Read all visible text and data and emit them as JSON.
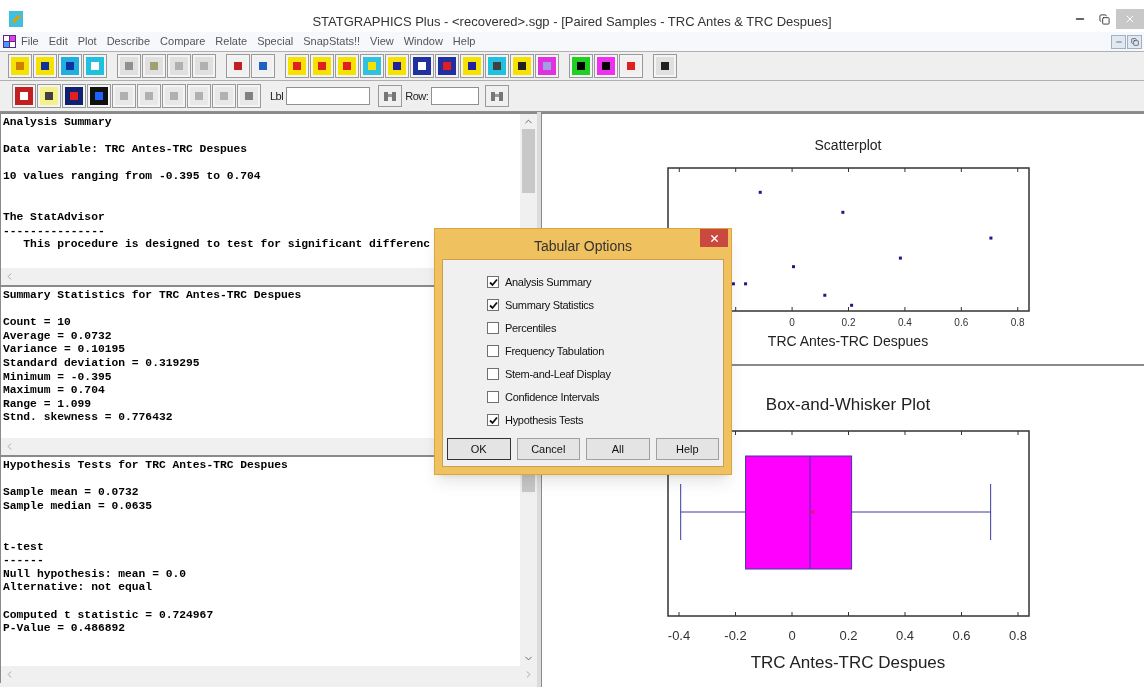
{
  "window": {
    "title": "STATGRAPHICS Plus - <recovered>.sgp - [Paired Samples - TRC Antes & TRC Despues]"
  },
  "menu": [
    "File",
    "Edit",
    "Plot",
    "Describe",
    "Compare",
    "Relate",
    "Special",
    "SnapStats!!",
    "View",
    "Window",
    "Help"
  ],
  "toolbar2": {
    "label_field": {
      "label": "Lbl"
    },
    "row_field": {
      "label": "Row:"
    }
  },
  "panes": [
    {
      "groups": [
        {
          "kind": "para",
          "lines": [
            "Analysis Summary"
          ]
        },
        {
          "kind": "para",
          "lines": [
            "Data variable: TRC Antes-TRC Despues"
          ]
        },
        {
          "kind": "para",
          "lines": [
            "10 values ranging from -0.395 to 0.704"
          ]
        },
        {
          "kind": "section",
          "lines": [
            "The StatAdvisor",
            "---------------",
            "   This procedure is designed to test for significant differenc"
          ]
        }
      ]
    },
    {
      "groups": [
        {
          "kind": "para",
          "lines": [
            "Summary Statistics for TRC Antes-TRC Despues"
          ]
        },
        {
          "kind": "para",
          "lines": [
            "Count = 10",
            "Average = 0.0732",
            "Variance = 0.10195",
            "Standard deviation = 0.319295",
            "Minimum = -0.395",
            "Maximum = 0.704",
            "Range = 1.099",
            "Stnd. skewness = 0.776432"
          ]
        }
      ]
    },
    {
      "groups": [
        {
          "kind": "para",
          "lines": [
            "Hypothesis Tests for TRC Antes-TRC Despues"
          ]
        },
        {
          "kind": "para",
          "lines": [
            "Sample mean = 0.0732",
            "Sample median = 0.0635"
          ]
        },
        {
          "kind": "section",
          "lines": [
            "t-test",
            "------",
            "Null hypothesis: mean = 0.0",
            "Alternative: not equal"
          ]
        },
        {
          "kind": "para",
          "lines": [
            "Computed t statistic = 0.724967",
            "P-Value = 0.486892"
          ]
        }
      ]
    }
  ],
  "scatterplot": {
    "title": "Scatterplot",
    "xlabel": "TRC Antes-TRC Despues",
    "tick_labels": [
      "0",
      "0.2",
      "0.4",
      "0.6",
      "0.8"
    ]
  },
  "boxplot": {
    "title": "Box-and-Whisker Plot",
    "xlabel": "TRC Antes-TRC Despues",
    "tick_labels": [
      "-0.4",
      "-0.2",
      "0",
      "0.2",
      "0.4",
      "0.6",
      "0.8"
    ]
  },
  "dialog": {
    "title": "Tabular Options",
    "options": [
      {
        "label": "Analysis Summary",
        "checked": true
      },
      {
        "label": "Summary Statistics",
        "checked": true
      },
      {
        "label": "Percentiles",
        "checked": false
      },
      {
        "label": "Frequency Tabulation",
        "checked": false
      },
      {
        "label": "Stem-and-Leaf Display",
        "checked": false
      },
      {
        "label": "Confidence Intervals",
        "checked": false
      },
      {
        "label": "Hypothesis Tests",
        "checked": true
      }
    ],
    "buttons": [
      "OK",
      "Cancel",
      "All",
      "Help"
    ]
  }
}
